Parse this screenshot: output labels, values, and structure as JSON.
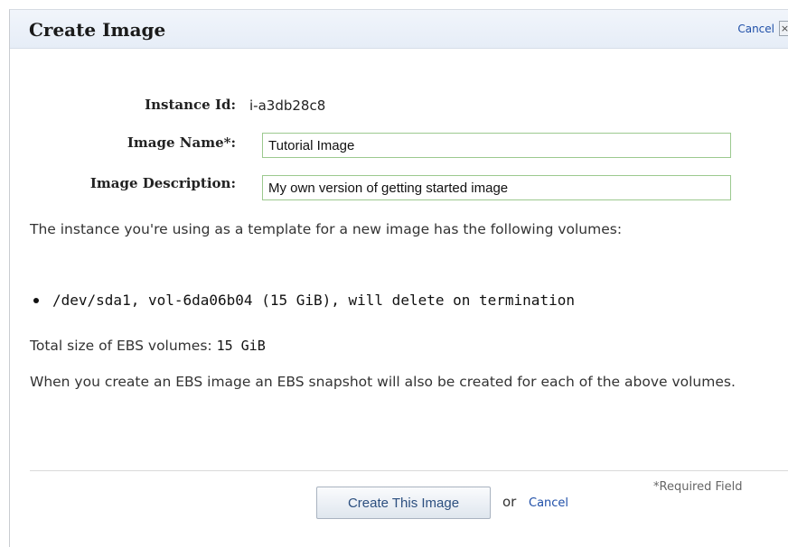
{
  "dialog": {
    "title": "Create Image",
    "cancel_label": "Cancel",
    "close_glyph": "×"
  },
  "form": {
    "instance_id_label": "Instance Id:",
    "instance_id_value": "i-a3db28c8",
    "image_name_label": "Image Name*:",
    "image_name_value": "Tutorial Image",
    "image_description_label": "Image Description:",
    "image_description_value": "My own version of getting started image"
  },
  "info": {
    "volumes_intro": "The instance you're using as a template for a new image has the following volumes:",
    "volumes": [
      "/dev/sda1, vol-6da06b04 (15 GiB), will delete on termination"
    ],
    "total_size_label": "Total size of EBS volumes:",
    "total_size_value": "15 GiB",
    "snapshot_note": "When you create an EBS image an EBS snapshot will also be created for each of the above volumes."
  },
  "footer": {
    "create_button_label": "Create This Image",
    "or_text": "or",
    "cancel_label": "Cancel",
    "required_note": "*Required Field"
  },
  "colors": {
    "titlebar_bg": "#e9eff8",
    "link": "#1f4fa8",
    "field_border": "#9cc98f"
  }
}
